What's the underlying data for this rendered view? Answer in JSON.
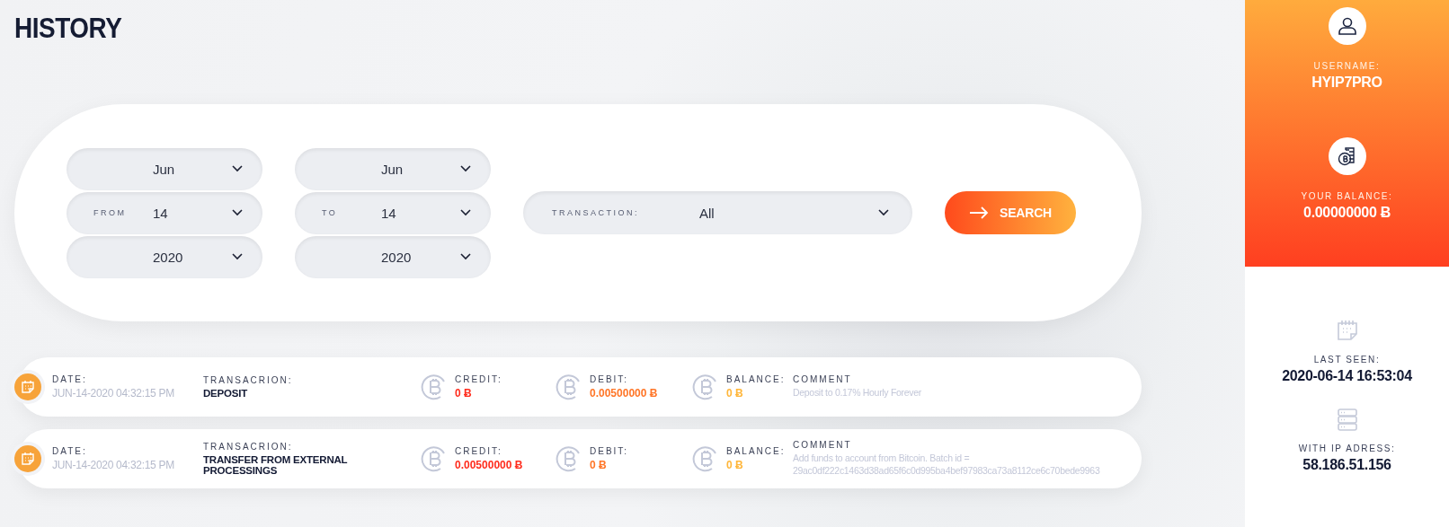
{
  "page": {
    "title": "HISTORY"
  },
  "filters": {
    "from": {
      "fields": [
        {
          "value": "Jun"
        },
        {
          "label": "FROM",
          "value": "14"
        },
        {
          "value": "2020"
        }
      ]
    },
    "to": {
      "fields": [
        {
          "value": "Jun"
        },
        {
          "label": "TO",
          "value": "14"
        },
        {
          "value": "2020"
        }
      ]
    },
    "transaction": {
      "label": "TRANSACTION:",
      "value": "All"
    },
    "search_button": {
      "label": "SEARCH"
    }
  },
  "transactions": [
    {
      "date_label": "DATE:",
      "date": "JUN-14-2020 04:32:15 PM",
      "type_label": "TRANSACRION:",
      "type": "DEPOSIT",
      "credit_label": "CREDIT:",
      "credit": "0 Ƀ",
      "debit_label": "DEBIT:",
      "debit": "0.00500000 Ƀ",
      "balance_label": "BALANCE:",
      "balance": "0 Ƀ",
      "comment_label": "COMMENT",
      "comment": "Deposit to 0.17% Hourly Forever"
    },
    {
      "date_label": "DATE:",
      "date": "JUN-14-2020 04:32:15 PM",
      "type_label": "TRANSACRION:",
      "type": "TRANSFER FROM EXTERNAL PROCESSINGS",
      "credit_label": "CREDIT:",
      "credit": "0.00500000 Ƀ",
      "debit_label": "DEBIT:",
      "debit": "0 Ƀ",
      "balance_label": "BALANCE:",
      "balance": "0 Ƀ",
      "comment_label": "COMMENT",
      "comment": "Add funds to account from Bitcoin. Batch id = 29ac0df222c1463d38ad65f6c0d995ba4bef97983ca73a8112ce6c70bede9963"
    }
  ],
  "account": {
    "username_label": "USERNAME:",
    "username": "HYIP7PRO",
    "balance_label": "YOUR BALANCE:",
    "balance": "0.00000000 Ƀ",
    "last_seen_label": "LAST SEEN:",
    "last_seen": "2020-06-14 16:53:04",
    "ip_label": "WITH IP ADRESS:",
    "ip": "58.186.51.156"
  }
}
